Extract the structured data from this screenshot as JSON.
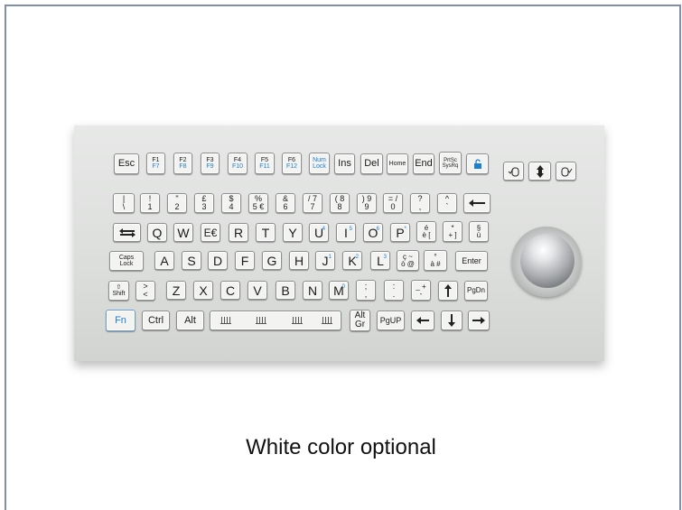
{
  "caption": "White color optional",
  "keys": {
    "esc": "Esc",
    "f1": "F1",
    "f7": "F7",
    "f2": "F2",
    "f8": "F8",
    "f3": "F3",
    "f9": "F9",
    "f4": "F4",
    "f10": "F10",
    "f5": "F5",
    "f11": "F11",
    "f6": "F6",
    "f12": "F12",
    "numlock": "Num\nLock",
    "ins": "Ins",
    "del": "Del",
    "home": "Home",
    "end": "End",
    "prtsc": "PrtSc\nSysRq",
    "n1": "!\n1",
    "n2": "\"\n2",
    "n3": "£\n3",
    "n4": "$\n4",
    "n5": "%\n5 €",
    "n6": "&\n6",
    "n7": "/ 7\n7",
    "n8": "( 8\n8",
    "n9": ") 9\n9",
    "n0": "= /\n0",
    "q1": "?\n,",
    "q2": "^\n`",
    "pipe": "|\n\\",
    "q": "Q",
    "w": "W",
    "e": "E€",
    "r": "R",
    "t": "T",
    "y": "Y",
    "u": "U",
    "i": "I",
    "o": "O",
    "p": "P",
    "eacute": "é\nè [",
    "star": "*\n+ ]",
    "para": "§\nù",
    "caps": "Caps\nLock",
    "a": "A",
    "s": "S",
    "d": "D",
    "f": "F",
    "g": "G",
    "h": "H",
    "j": "J",
    "k": "K",
    "l": "L",
    "ccedil": "ç ~\nò @",
    "deg": "°\nà #",
    "enter": "Enter",
    "shift": "⇧\nShift",
    "lt": ">\n<",
    "z": "Z",
    "x": "X",
    "c": "C",
    "v": "V",
    "b": "B",
    "n": "N",
    "m": "M",
    "semi": ";\n,",
    "colon": ":\n.",
    "minus": "_ +\n-",
    "pgdn": "PgDn",
    "fn": "Fn",
    "ctrl": "Ctrl",
    "alt": "Alt",
    "altgr": "Alt\nGr",
    "pgup": "PgUP",
    "sup_u": "4",
    "sup_i": "5",
    "sup_o": "6",
    "sup_p": "*",
    "sup_j": "1",
    "sup_k": "2",
    "sup_l": "3",
    "sup_m": "0"
  }
}
